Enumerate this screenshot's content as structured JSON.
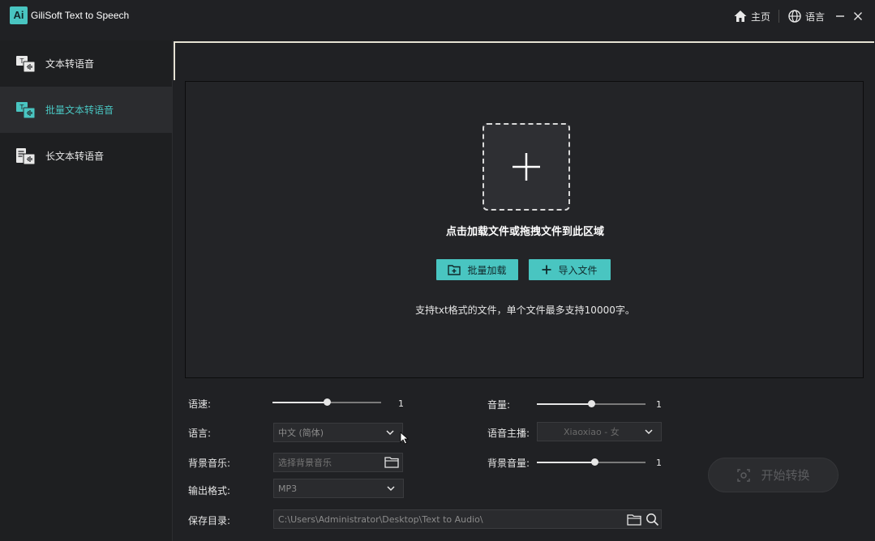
{
  "app": {
    "logo_text": "Ai",
    "title": "GiliSoft Text to Speech"
  },
  "titlebar": {
    "home_label": "主页",
    "language_label": "语言"
  },
  "sidebar": {
    "items": [
      {
        "label": "文本转语音",
        "active": false
      },
      {
        "label": "批量文本转语音",
        "active": true
      },
      {
        "label": "长文本转语音",
        "active": false
      }
    ]
  },
  "dropzone": {
    "instruction": "点击加载文件或拖拽文件到此区域",
    "batch_load_label": "批量加载",
    "import_file_label": "导入文件",
    "support_text": "支持txt格式的文件，单个文件最多支持10000字。"
  },
  "settings": {
    "speed": {
      "label": "语速:",
      "value": "1",
      "level": 0.5
    },
    "volume": {
      "label": "音量:",
      "value": "1",
      "level": 0.5
    },
    "language": {
      "label": "语言:",
      "selected": "中文 (简体)"
    },
    "voice": {
      "label": "语音主播:",
      "selected": "Xiaoxiao - 女"
    },
    "bg_music": {
      "label": "背景音乐:",
      "placeholder": "选择背景音乐"
    },
    "bg_volume": {
      "label": "背景音量:",
      "value": "1",
      "level": 0.53
    },
    "format": {
      "label": "输出格式:",
      "selected": "MP3"
    },
    "save_dir": {
      "label": "保存目录:",
      "value": "C:\\Users\\Administrator\\Desktop\\Text to Audio\\"
    }
  },
  "start_button": {
    "label": "开始转换"
  },
  "colors": {
    "accent": "#49c5c1",
    "background": "#202124"
  }
}
